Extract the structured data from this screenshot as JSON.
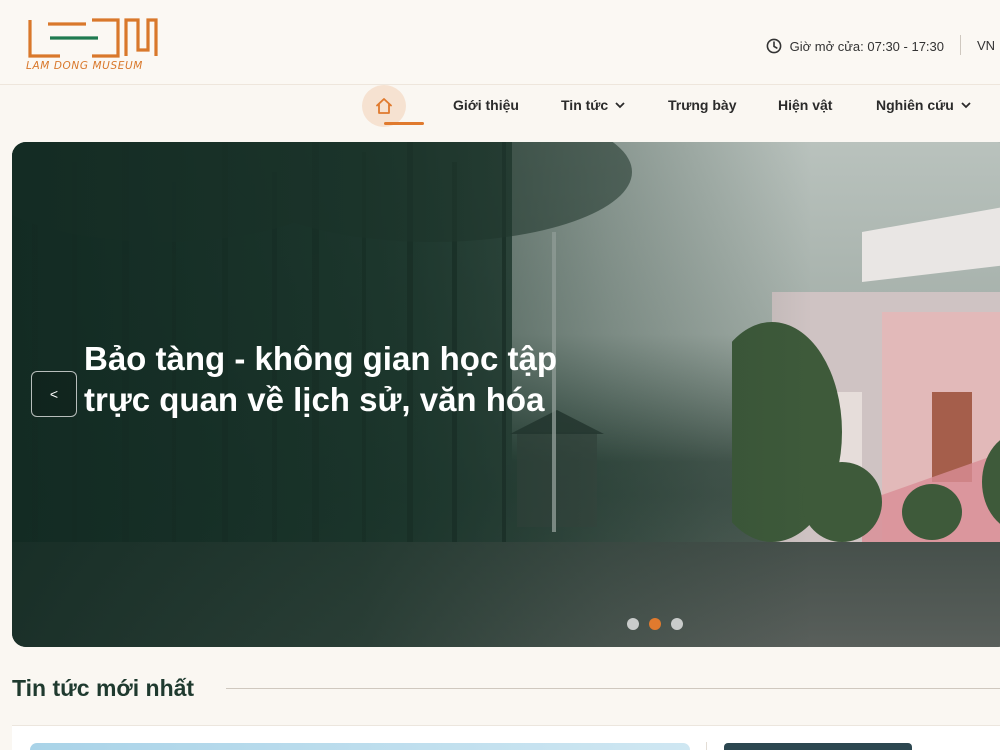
{
  "header": {
    "logo_text": "LAM DONG MUSEUM",
    "hours_label": "Giờ mở cửa: 07:30 - 17:30",
    "language": "VN"
  },
  "nav": {
    "items": [
      {
        "label": "Giới thiệu",
        "has_dropdown": false
      },
      {
        "label": "Tin tức",
        "has_dropdown": true
      },
      {
        "label": "Trưng bày",
        "has_dropdown": false
      },
      {
        "label": "Hiện vật",
        "has_dropdown": false
      },
      {
        "label": "Nghiên cứu",
        "has_dropdown": true
      }
    ],
    "home_icon": "home-icon"
  },
  "hero": {
    "title": "Bảo tàng - không gian học tập trực quan về lịch sử, văn hóa",
    "prev_label": "<",
    "slides_total": 3,
    "active_slide": 2
  },
  "latest_news": {
    "title": "Tin tức mới nhất"
  },
  "colors": {
    "accent": "#e07a2e",
    "brand_green": "#1f7a4f",
    "heading": "#1f3a2f"
  }
}
